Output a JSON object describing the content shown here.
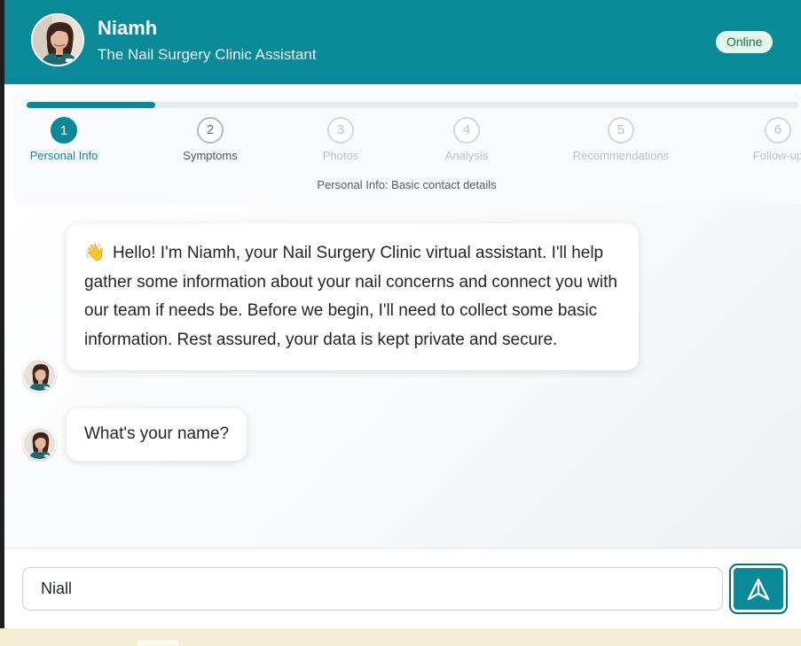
{
  "header": {
    "name": "Niamh",
    "subtitle": "The Nail Surgery Clinic Assistant",
    "status": "Online"
  },
  "progress": {
    "fraction_complete": 0.1667,
    "current_step": 1,
    "steps": [
      {
        "number": "1",
        "label": "Personal Info"
      },
      {
        "number": "2",
        "label": "Symptoms"
      },
      {
        "number": "3",
        "label": "Photos"
      },
      {
        "number": "4",
        "label": "Analysis"
      },
      {
        "number": "5",
        "label": "Recommendations"
      },
      {
        "number": "6",
        "label": "Follow-up"
      }
    ],
    "caption": "Personal Info: Basic contact details"
  },
  "messages": [
    {
      "sender": "assistant",
      "emoji": "👋",
      "text": "Hello! I'm Niamh, your Nail Surgery Clinic virtual assistant. I'll help gather some information about your nail concerns and connect you with our team if needs be. Before we begin, I'll need to collect some basic information. Rest assured, your data is kept private and secure."
    },
    {
      "sender": "assistant",
      "text": "What's your name?"
    }
  ],
  "composer": {
    "value": "Niall"
  },
  "icons": {
    "send": "send-arrow-icon",
    "avatar": "assistant-avatar"
  },
  "colors": {
    "brand": "#0a8a98",
    "status_bg": "#e4f8ec",
    "status_text": "#1d6e43"
  }
}
